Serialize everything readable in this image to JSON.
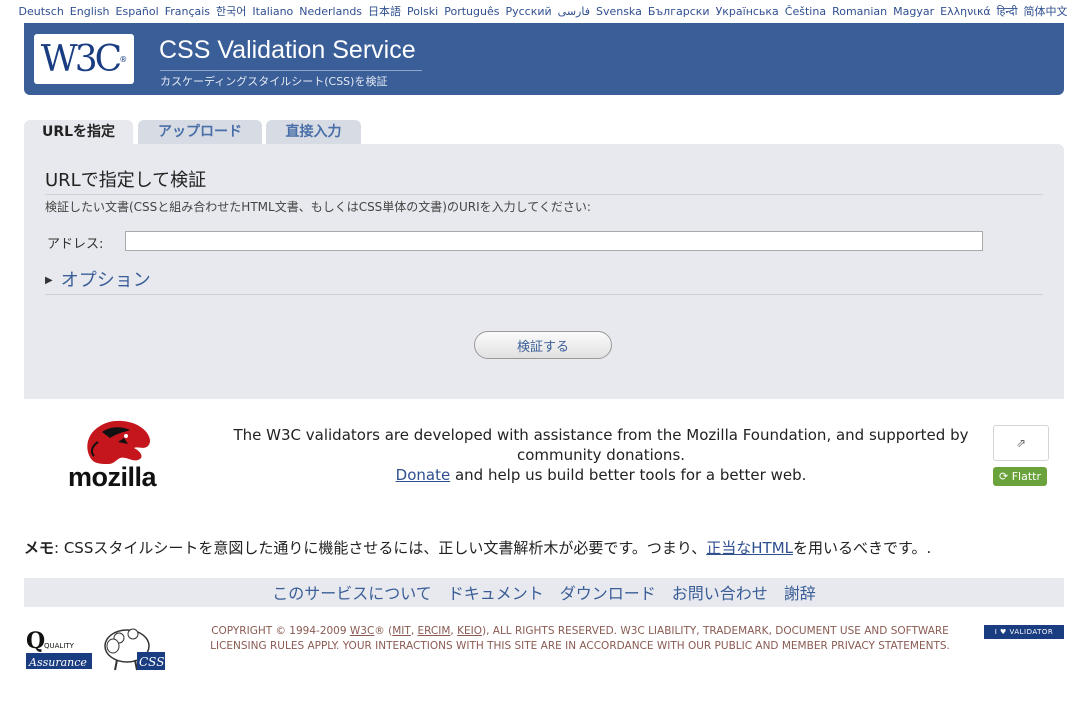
{
  "languages": [
    "Deutsch",
    "English",
    "Español",
    "Français",
    "한국어",
    "Italiano",
    "Nederlands",
    "日本語",
    "Polski",
    "Português",
    "Русский",
    "فارسی",
    "Svenska",
    "Български",
    "Українська",
    "Čeština",
    "Romanian",
    "Magyar",
    "Ελληνικά",
    "हिन्दी",
    "简体中文"
  ],
  "header": {
    "logo_text": "W3C",
    "title": "CSS Validation Service",
    "subtitle": "カスケーディングスタイルシート(CSS)を検証"
  },
  "tabs": [
    {
      "label": "URLを指定"
    },
    {
      "label": "アップロード"
    },
    {
      "label": "直接入力"
    }
  ],
  "form": {
    "heading": "URLで指定して検証",
    "description": "検証したい文書(CSSと組み合わせたHTML文書、もしくはCSS単体の文書)のURIを入力してください:",
    "address_label": "アドレス:",
    "address_value": "",
    "options_label": "オプション",
    "submit_label": "検証する"
  },
  "mozilla": {
    "logo_word": "mozilla",
    "line1": "The W3C validators are developed with assistance from the Mozilla Foundation, and supported by community donations.",
    "donate_link": "Donate",
    "line2": " and help us build better tools for a better web.",
    "flattr_label": "Flattr"
  },
  "note": {
    "label": "メモ",
    "text_before": ": CSSスタイルシートを意図した通りに機能させるには、正しい文書解析木が必要です。つまり、",
    "link": "正当なHTML",
    "text_after": "を用いるべきです。."
  },
  "footer_nav": [
    "このサービスについて",
    "ドキュメント",
    "ダウンロード",
    "お問い合わせ",
    "謝辞"
  ],
  "copyright": {
    "prefix": "COPYRIGHT © 1994-2009 ",
    "w3c": "W3C",
    "mid": "® (",
    "mit": "MIT",
    "ercim": "ERCIM",
    "keio": "KEIO",
    "rest": "), ALL RIGHTS RESERVED. W3C LIABILITY, TRADEMARK, DOCUMENT USE AND SOFTWARE LICENSING RULES APPLY. YOUR INTERACTIONS WITH THIS SITE ARE IN ACCORDANCE WITH OUR PUBLIC AND MEMBER PRIVACY STATEMENTS."
  },
  "badges": {
    "qa_top": "QUALITY",
    "qa_bottom": "Assurance",
    "css_badge": "CSS",
    "ilove": "I ♥ VALIDATOR"
  },
  "colors": {
    "banner": "#3a5e98",
    "panel": "#e8e9ee",
    "link": "#2f4f8f",
    "flattr": "#6aa33c"
  }
}
